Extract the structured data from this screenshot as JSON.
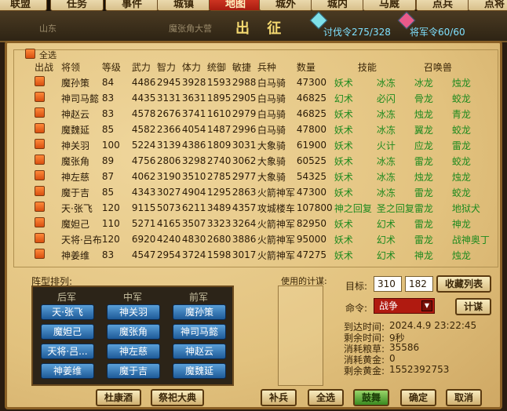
{
  "nav": {
    "tabs": [
      "联盟",
      "任务",
      "事件",
      "城镇",
      "地图",
      "城外",
      "城内",
      "马厩",
      "点兵",
      "点将"
    ],
    "active": "地图"
  },
  "header": {
    "title": "出 征",
    "bg_left": "山东",
    "bg_mid": "魔张角大营",
    "taofa": "讨伐令275/328",
    "jiangjun": "将军令60/60"
  },
  "select_all": "全选",
  "table": {
    "headers": [
      "出战",
      "将领",
      "等级",
      "武力",
      "智力",
      "体力",
      "统御",
      "敏捷",
      "兵种",
      "数量",
      "技能",
      "",
      "召唤兽",
      ""
    ],
    "rows": [
      {
        "name": "魔孙策",
        "lv": "84",
        "wu": "4486",
        "zhi": "2945",
        "ti": "3928",
        "tong": "1593",
        "min": "2988",
        "bing": "白马骑",
        "num": "47300",
        "s1": "妖术",
        "s2": "冰冻",
        "z1": "冰龙",
        "z2": "烛龙"
      },
      {
        "name": "神司马懿",
        "lv": "83",
        "wu": "4435",
        "zhi": "3131",
        "ti": "3631",
        "tong": "1895",
        "min": "2905",
        "bing": "白马骑",
        "num": "46825",
        "s1": "幻术",
        "s2": "必闪",
        "z1": "骨龙",
        "z2": "蛟龙"
      },
      {
        "name": "神赵云",
        "lv": "83",
        "wu": "4578",
        "zhi": "2676",
        "ti": "3741",
        "tong": "1610",
        "min": "2979",
        "bing": "白马骑",
        "num": "46825",
        "s1": "妖术",
        "s2": "冰冻",
        "z1": "烛龙",
        "z2": "青龙"
      },
      {
        "name": "魔魏延",
        "lv": "85",
        "wu": "4582",
        "zhi": "2366",
        "ti": "4054",
        "tong": "1487",
        "min": "2996",
        "bing": "白马骑",
        "num": "47800",
        "s1": "妖术",
        "s2": "冰冻",
        "z1": "翼龙",
        "z2": "蛟龙"
      },
      {
        "name": "神关羽",
        "lv": "100",
        "wu": "5224",
        "zhi": "3139",
        "ti": "4386",
        "tong": "1809",
        "min": "3031",
        "bing": "大象骑",
        "num": "61900",
        "s1": "妖术",
        "s2": "火计",
        "z1": "应龙",
        "z2": "雷龙"
      },
      {
        "name": "魔张角",
        "lv": "89",
        "wu": "4756",
        "zhi": "2806",
        "ti": "3298",
        "tong": "2740",
        "min": "3062",
        "bing": "大象骑",
        "num": "60525",
        "s1": "妖术",
        "s2": "冰冻",
        "z1": "雷龙",
        "z2": "蛟龙"
      },
      {
        "name": "神左慈",
        "lv": "87",
        "wu": "4062",
        "zhi": "3190",
        "ti": "3510",
        "tong": "2785",
        "min": "2977",
        "bing": "大象骑",
        "num": "54325",
        "s1": "妖术",
        "s2": "冰冻",
        "z1": "烛龙",
        "z2": "烛龙"
      },
      {
        "name": "魔于吉",
        "lv": "85",
        "wu": "4343",
        "zhi": "3027",
        "ti": "4904",
        "tong": "1295",
        "min": "2863",
        "bing": "火箭神军",
        "num": "47300",
        "s1": "妖术",
        "s2": "冰冻",
        "z1": "雷龙",
        "z2": "蛟龙"
      },
      {
        "name": "天·张飞",
        "lv": "120",
        "wu": "9115",
        "zhi": "5073",
        "ti": "6211",
        "tong": "3489",
        "min": "4357",
        "bing": "攻城楼车",
        "num": "107800",
        "s1": "神之回复",
        "s2": "圣之回复",
        "z1": "雷龙",
        "z2": "地狱犬"
      },
      {
        "name": "魔妲己",
        "lv": "110",
        "wu": "5271",
        "zhi": "4165",
        "ti": "3507",
        "tong": "3323",
        "min": "3264",
        "bing": "火箭神军",
        "num": "82950",
        "s1": "妖术",
        "s2": "幻术",
        "z1": "雷龙",
        "z2": "神龙"
      },
      {
        "name": "天将·吕布",
        "lv": "120",
        "wu": "6920",
        "zhi": "4240",
        "ti": "4830",
        "tong": "2680",
        "min": "3886",
        "bing": "火箭神军",
        "num": "95000",
        "s1": "妖术",
        "s2": "幻术",
        "z1": "雷龙",
        "z2": "战神奥丁"
      },
      {
        "name": "神姜维",
        "lv": "83",
        "wu": "4547",
        "zhi": "2954",
        "ti": "3724",
        "tong": "1598",
        "min": "3017",
        "bing": "火箭神军",
        "num": "47275",
        "s1": "妖术",
        "s2": "幻术",
        "z1": "神龙",
        "z2": "烛龙"
      }
    ]
  },
  "formation": {
    "label": "阵型排列:",
    "headers": [
      "后军",
      "中军",
      "前军"
    ],
    "rows": [
      [
        "天·张飞",
        "神关羽",
        "魔孙策"
      ],
      [
        "魔妲己",
        "魔张角",
        "神司马懿"
      ],
      [
        "天将·吕...",
        "神左慈",
        "神赵云"
      ],
      [
        "神姜维",
        "魔于吉",
        "魔魏延"
      ]
    ]
  },
  "used": {
    "label": "使用的计谋:"
  },
  "target": {
    "label": "目标:",
    "x": "310",
    "y": "182",
    "fav_button": "收藏列表"
  },
  "command": {
    "label": "命令:",
    "value": "战争",
    "plan_button": "计谋"
  },
  "info": {
    "arrive_label": "到达时间:",
    "arrive_value": "2024.4.9   23:22:45",
    "remain_label": "剩余时间:",
    "remain_value": "9秒",
    "food_label": "消耗粮草:",
    "food_value": "35586",
    "gold_label": "消耗黄金:",
    "gold_value": "0",
    "left_label": "剩余黄金:",
    "left_value": "1552392753"
  },
  "buttons": {
    "dukang": "杜康酒",
    "jisi": "祭祀大典",
    "bubing": "补兵",
    "quanxuan": "全选",
    "guwu": "鼓舞",
    "queding": "确定",
    "quxiao": "取消"
  }
}
